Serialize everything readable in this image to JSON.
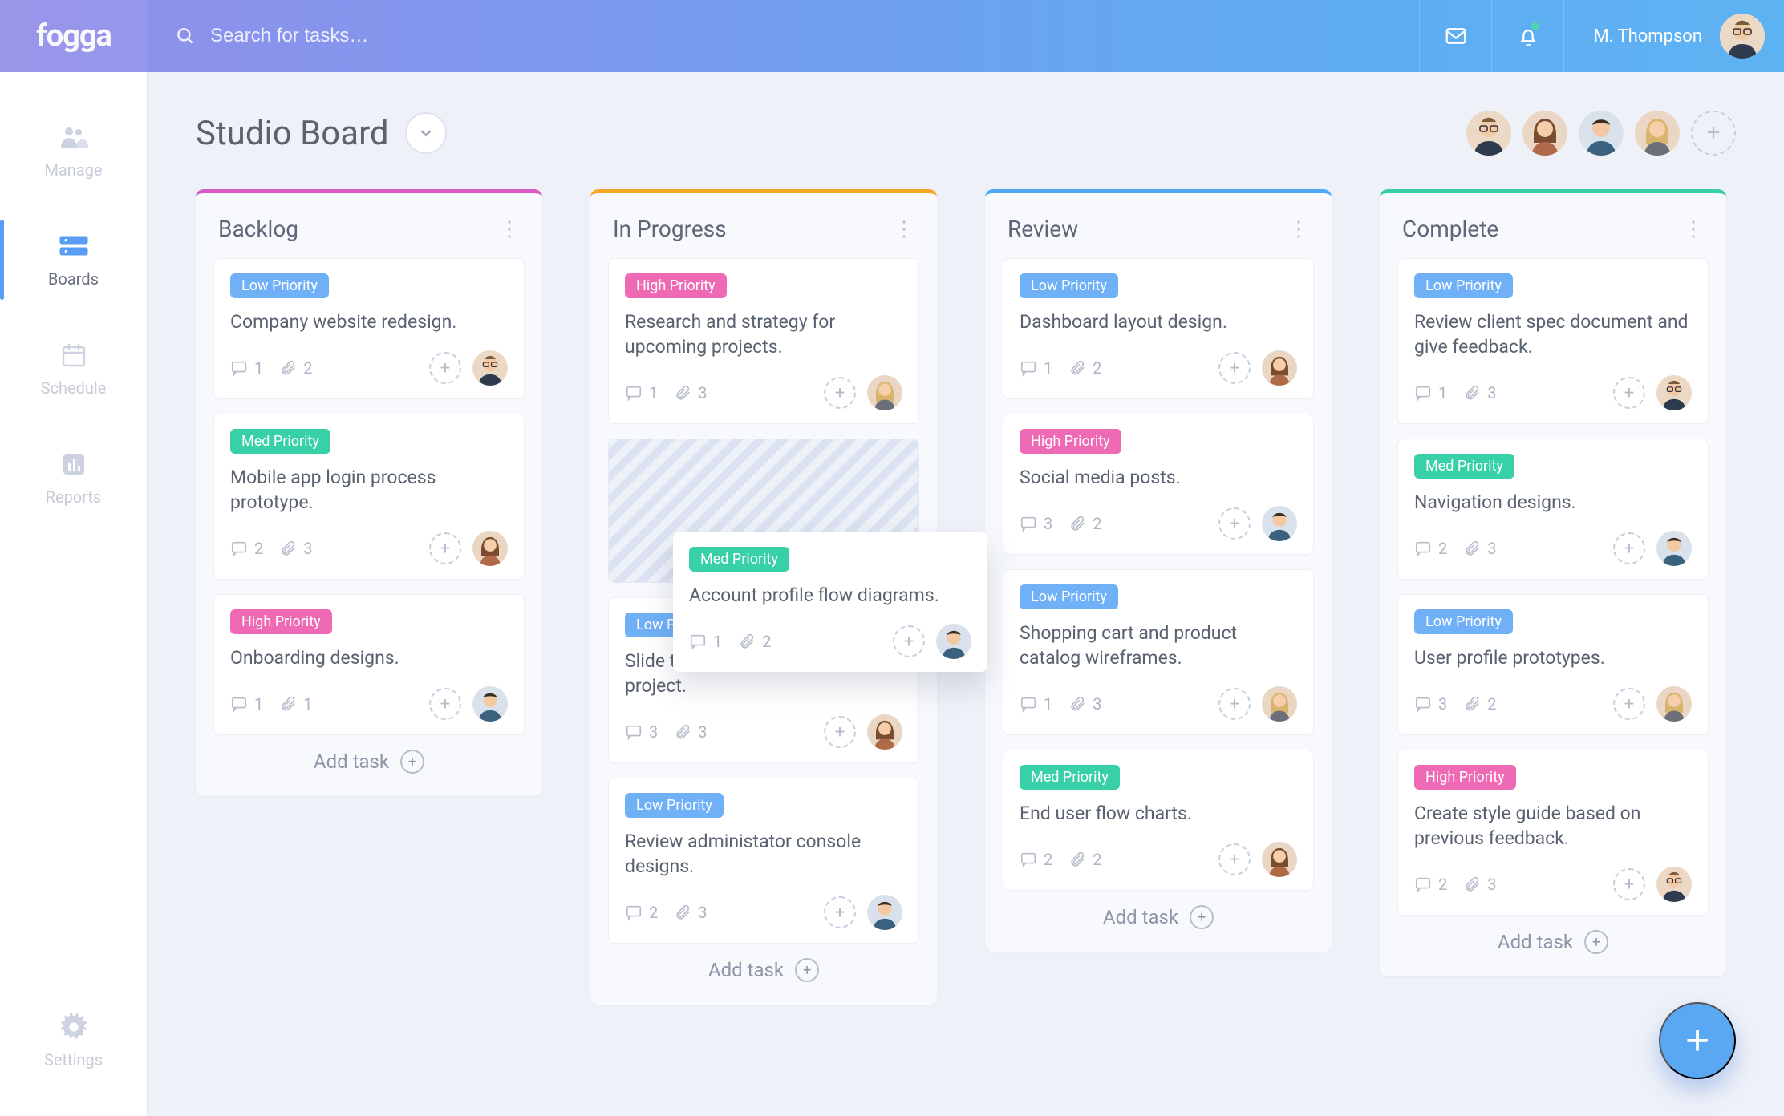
{
  "brand": "fogga",
  "search": {
    "placeholder": "Search for tasks…"
  },
  "user": {
    "name": "M. Thompson"
  },
  "sidebar": {
    "items": [
      {
        "label": "Manage"
      },
      {
        "label": "Boards"
      },
      {
        "label": "Schedule"
      },
      {
        "label": "Reports"
      },
      {
        "label": "Settings"
      }
    ]
  },
  "board": {
    "title": "Studio Board",
    "add_task_label": "Add task"
  },
  "priorities": {
    "low": "Low Priority",
    "med": "Med Priority",
    "high": "High Priority"
  },
  "columns": [
    {
      "key": "backlog",
      "title": "Backlog",
      "cards": [
        {
          "priority": "low",
          "title": "Company website redesign.",
          "comments": 1,
          "attachments": 2,
          "avatar": "m1"
        },
        {
          "priority": "med",
          "title": "Mobile app login process prototype.",
          "comments": 2,
          "attachments": 3,
          "avatar": "f1"
        },
        {
          "priority": "high",
          "title": "Onboarding designs.",
          "comments": 1,
          "attachments": 1,
          "avatar": "m2"
        }
      ]
    },
    {
      "key": "progress",
      "title": "In Progress",
      "cards": [
        {
          "priority": "high",
          "title": "Research and strategy for upcoming projects.",
          "comments": 1,
          "attachments": 3,
          "avatar": "f2"
        },
        {
          "ghost": true
        },
        {
          "priority": "low",
          "title": "Slide templates for client pitch project.",
          "comments": 3,
          "attachments": 3,
          "avatar": "f1",
          "badge_truncated": "Low Pri"
        },
        {
          "priority": "low",
          "title": "Review administator console designs.",
          "comments": 2,
          "attachments": 3,
          "avatar": "m2"
        }
      ],
      "floating": {
        "priority": "med",
        "title": "Account profile flow diagrams.",
        "comments": 1,
        "attachments": 2,
        "avatar": "m2"
      }
    },
    {
      "key": "review",
      "title": "Review",
      "cards": [
        {
          "priority": "low",
          "title": "Dashboard layout design.",
          "comments": 1,
          "attachments": 2,
          "avatar": "f1"
        },
        {
          "priority": "high",
          "title": "Social media posts.",
          "comments": 3,
          "attachments": 2,
          "avatar": "m2"
        },
        {
          "priority": "low",
          "title": "Shopping cart and product catalog wireframes.",
          "comments": 1,
          "attachments": 3,
          "avatar": "f2"
        },
        {
          "priority": "med",
          "title": "End user flow charts.",
          "comments": 2,
          "attachments": 2,
          "avatar": "f1"
        }
      ]
    },
    {
      "key": "complete",
      "title": "Complete",
      "cards": [
        {
          "priority": "low",
          "title": "Review client spec document and give feedback.",
          "comments": 1,
          "attachments": 3,
          "avatar": "m1"
        },
        {
          "priority": "med",
          "title": "Navigation designs.",
          "comments": 2,
          "attachments": 3,
          "avatar": "m2"
        },
        {
          "priority": "low",
          "title": "User profile prototypes.",
          "comments": 3,
          "attachments": 2,
          "avatar": "f2"
        },
        {
          "priority": "high",
          "title": "Create style guide based on previous feedback.",
          "comments": 2,
          "attachments": 3,
          "avatar": "m1"
        }
      ]
    }
  ]
}
